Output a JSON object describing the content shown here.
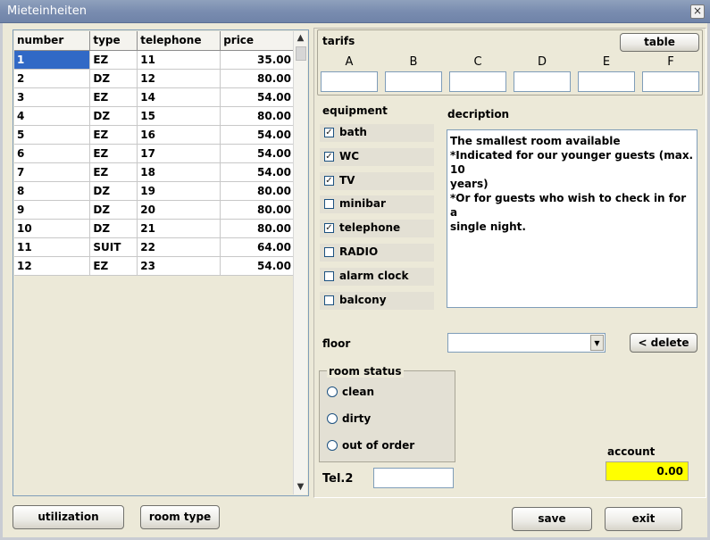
{
  "window": {
    "title": "Mieteinheiten",
    "close_glyph": "×"
  },
  "grid": {
    "columns": [
      "number",
      "type",
      "telephone",
      "price"
    ],
    "rows": [
      [
        "1",
        "EZ",
        "11",
        "35.00"
      ],
      [
        "2",
        "DZ",
        "12",
        "80.00"
      ],
      [
        "3",
        "EZ",
        "14",
        "54.00"
      ],
      [
        "4",
        "DZ",
        "15",
        "80.00"
      ],
      [
        "5",
        "EZ",
        "16",
        "54.00"
      ],
      [
        "6",
        "EZ",
        "17",
        "54.00"
      ],
      [
        "7",
        "EZ",
        "18",
        "54.00"
      ],
      [
        "8",
        "DZ",
        "19",
        "80.00"
      ],
      [
        "9",
        "DZ",
        "20",
        "80.00"
      ],
      [
        "10",
        "DZ",
        "21",
        "80.00"
      ],
      [
        "11",
        "SUIT",
        "22",
        "64.00"
      ],
      [
        "12",
        "EZ",
        "23",
        "54.00"
      ]
    ],
    "selected_row": 0
  },
  "tarifs": {
    "label": "tarifs",
    "table_button": "table",
    "columns": [
      "A",
      "B",
      "C",
      "D",
      "E",
      "F"
    ]
  },
  "equipment": {
    "label": "equipment",
    "items": [
      {
        "label": "bath",
        "checked": true,
        "mark": "✓"
      },
      {
        "label": "WC",
        "checked": true,
        "mark": "✓"
      },
      {
        "label": "TV",
        "checked": true,
        "mark": "✓"
      },
      {
        "label": "minibar",
        "checked": false,
        "mark": ""
      },
      {
        "label": "telephone",
        "checked": true,
        "mark": "✓"
      },
      {
        "label": "RADIO",
        "checked": false,
        "mark": ""
      },
      {
        "label": "alarm clock",
        "checked": false,
        "mark": ""
      },
      {
        "label": "balcony",
        "checked": false,
        "mark": ""
      }
    ]
  },
  "description": {
    "label": "decription",
    "lines": [
      "The smallest room available",
      "*Indicated for our younger guests (max. 10",
      "years)",
      "*Or for guests who wish to check in for a",
      "single night."
    ]
  },
  "floor": {
    "label": "floor",
    "value": "",
    "delete_button": "< delete"
  },
  "room_status": {
    "label": "room status",
    "options": [
      "clean",
      "dirty",
      "out of order"
    ]
  },
  "tel2": {
    "label": "Tel.2",
    "value": ""
  },
  "account": {
    "label": "account",
    "value": "0.00"
  },
  "buttons": {
    "utilization": "utilization",
    "room_type": "room type",
    "save": "save",
    "exit": "exit"
  },
  "colors": {
    "selection": "#3169c6",
    "account_bg": "#ffff00",
    "window_bg": "#ece9d8"
  }
}
